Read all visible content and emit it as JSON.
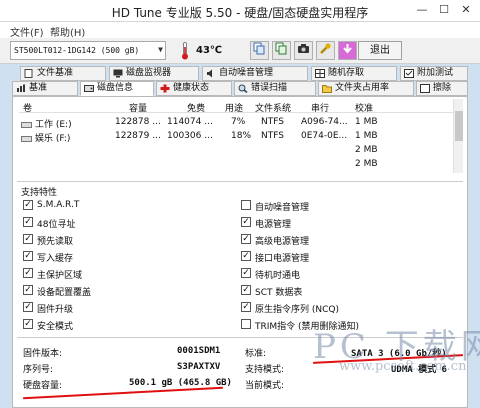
{
  "window": {
    "title": "HD Tune 专业版 5.50 - 硬盘/固态硬盘实用程序",
    "minimize": "—",
    "maximize": "☐",
    "close": "✕"
  },
  "menu": {
    "file": "文件(F)",
    "help": "帮助(H)"
  },
  "toolbar": {
    "drive": "ST500LT012-1DG142 (500 gB)",
    "temperature": "43℃",
    "exit_label": "退出",
    "icons": [
      "copy-icon",
      "copy-info-icon",
      "screenshot-icon",
      "options-icon",
      "save-icon"
    ]
  },
  "tabs": {
    "row1": [
      "文件基准",
      "磁盘监视器",
      "自动噪音管理",
      "随机存取",
      "附加测试"
    ],
    "row2": [
      "基准",
      "磁盘信息",
      "健康状态",
      "错误扫描",
      "文件夹占用率",
      "擦除"
    ],
    "active": "磁盘信息"
  },
  "partitions": {
    "headers": [
      "卷",
      "容量",
      "免费",
      "用途",
      "文件系统",
      "串行",
      "校准"
    ],
    "rows": [
      {
        "vol": "工作 (E:)",
        "capacity": "122878 ...",
        "free": "114074 ...",
        "usage": "7%",
        "fs": "NTFS",
        "serial": "A096-74...",
        "align": "1 MB"
      },
      {
        "vol": "娱乐 (F:)",
        "capacity": "122879 ...",
        "free": "100306 ...",
        "usage": "18%",
        "fs": "NTFS",
        "serial": "0E74-0E...",
        "align": "1 MB"
      },
      {
        "vol": "",
        "capacity": "",
        "free": "",
        "usage": "",
        "fs": "",
        "serial": "",
        "align": "2 MB"
      },
      {
        "vol": "",
        "capacity": "",
        "free": "",
        "usage": "",
        "fs": "",
        "serial": "",
        "align": "2 MB"
      }
    ]
  },
  "features": {
    "title": "支持特性",
    "left": [
      {
        "label": "S.M.A.R.T",
        "checked": true
      },
      {
        "label": "48位寻址",
        "checked": true
      },
      {
        "label": "预先读取",
        "checked": true
      },
      {
        "label": "写入缓存",
        "checked": true
      },
      {
        "label": "主保护区域",
        "checked": true
      },
      {
        "label": "设备配置覆盖",
        "checked": true
      },
      {
        "label": "固件升级",
        "checked": true
      },
      {
        "label": "安全模式",
        "checked": true
      }
    ],
    "right": [
      {
        "label": "自动噪音管理",
        "checked": false
      },
      {
        "label": "电源管理",
        "checked": true
      },
      {
        "label": "高级电源管理",
        "checked": true
      },
      {
        "label": "接口电源管理",
        "checked": true
      },
      {
        "label": "待机时通电",
        "checked": true
      },
      {
        "label": "SCT 数据表",
        "checked": true
      },
      {
        "label": "原生指令序列 (NCQ)",
        "checked": true
      },
      {
        "label": "TRIM指令 (禁用删除通知)",
        "checked": false
      }
    ]
  },
  "info": {
    "firmware_label": "固件版本:",
    "firmware_value": "0001SDM1",
    "serial_label": "序列号:",
    "serial_value": "S3PAXTXV",
    "capacity_label": "硬盘容量:",
    "capacity_value": "500.1 gB (465.8 GB)",
    "standard_label": "标准:",
    "standard_value": "SATA 3 (6.0 Gb/秒)",
    "supported_label": "支持模式:",
    "supported_value": "UDMA 模式 6",
    "current_label": "当前模式:",
    "current_value": ""
  },
  "watermark": {
    "brand": "PC 下载网",
    "url": "www.pcsoft.com.cn"
  },
  "colors": {
    "annotation_red": "#e01010",
    "checkbox_check": "#111111"
  }
}
